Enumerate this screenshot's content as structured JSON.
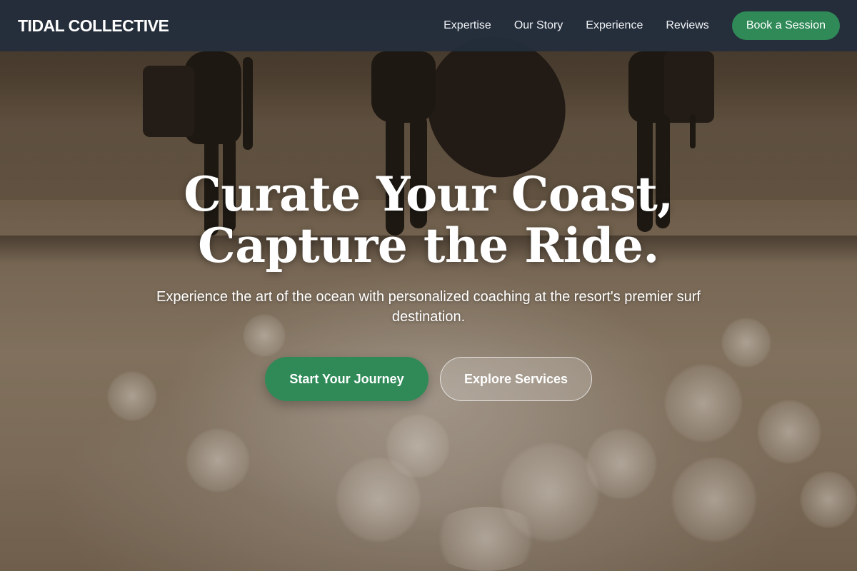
{
  "brand": {
    "name": "TIDAL COLLECTIVE"
  },
  "nav": {
    "links": [
      {
        "label": "Expertise"
      },
      {
        "label": "Our Story"
      },
      {
        "label": "Experience"
      },
      {
        "label": "Reviews"
      }
    ],
    "cta_label": "Book a Session"
  },
  "hero": {
    "title_line1": "Curate Your Coast,",
    "title_line2": "Capture the Ride.",
    "subtitle": "Experience the art of the ocean with personalized coaching at the resort's premier surf destination.",
    "primary_button": "Start Your Journey",
    "secondary_button": "Explore Services",
    "background_image": "surfers-walking-on-beach-silhouette"
  },
  "colors": {
    "nav_bg": "#242d3c",
    "accent_green": "#2f8a58",
    "text_white": "#ffffff"
  }
}
